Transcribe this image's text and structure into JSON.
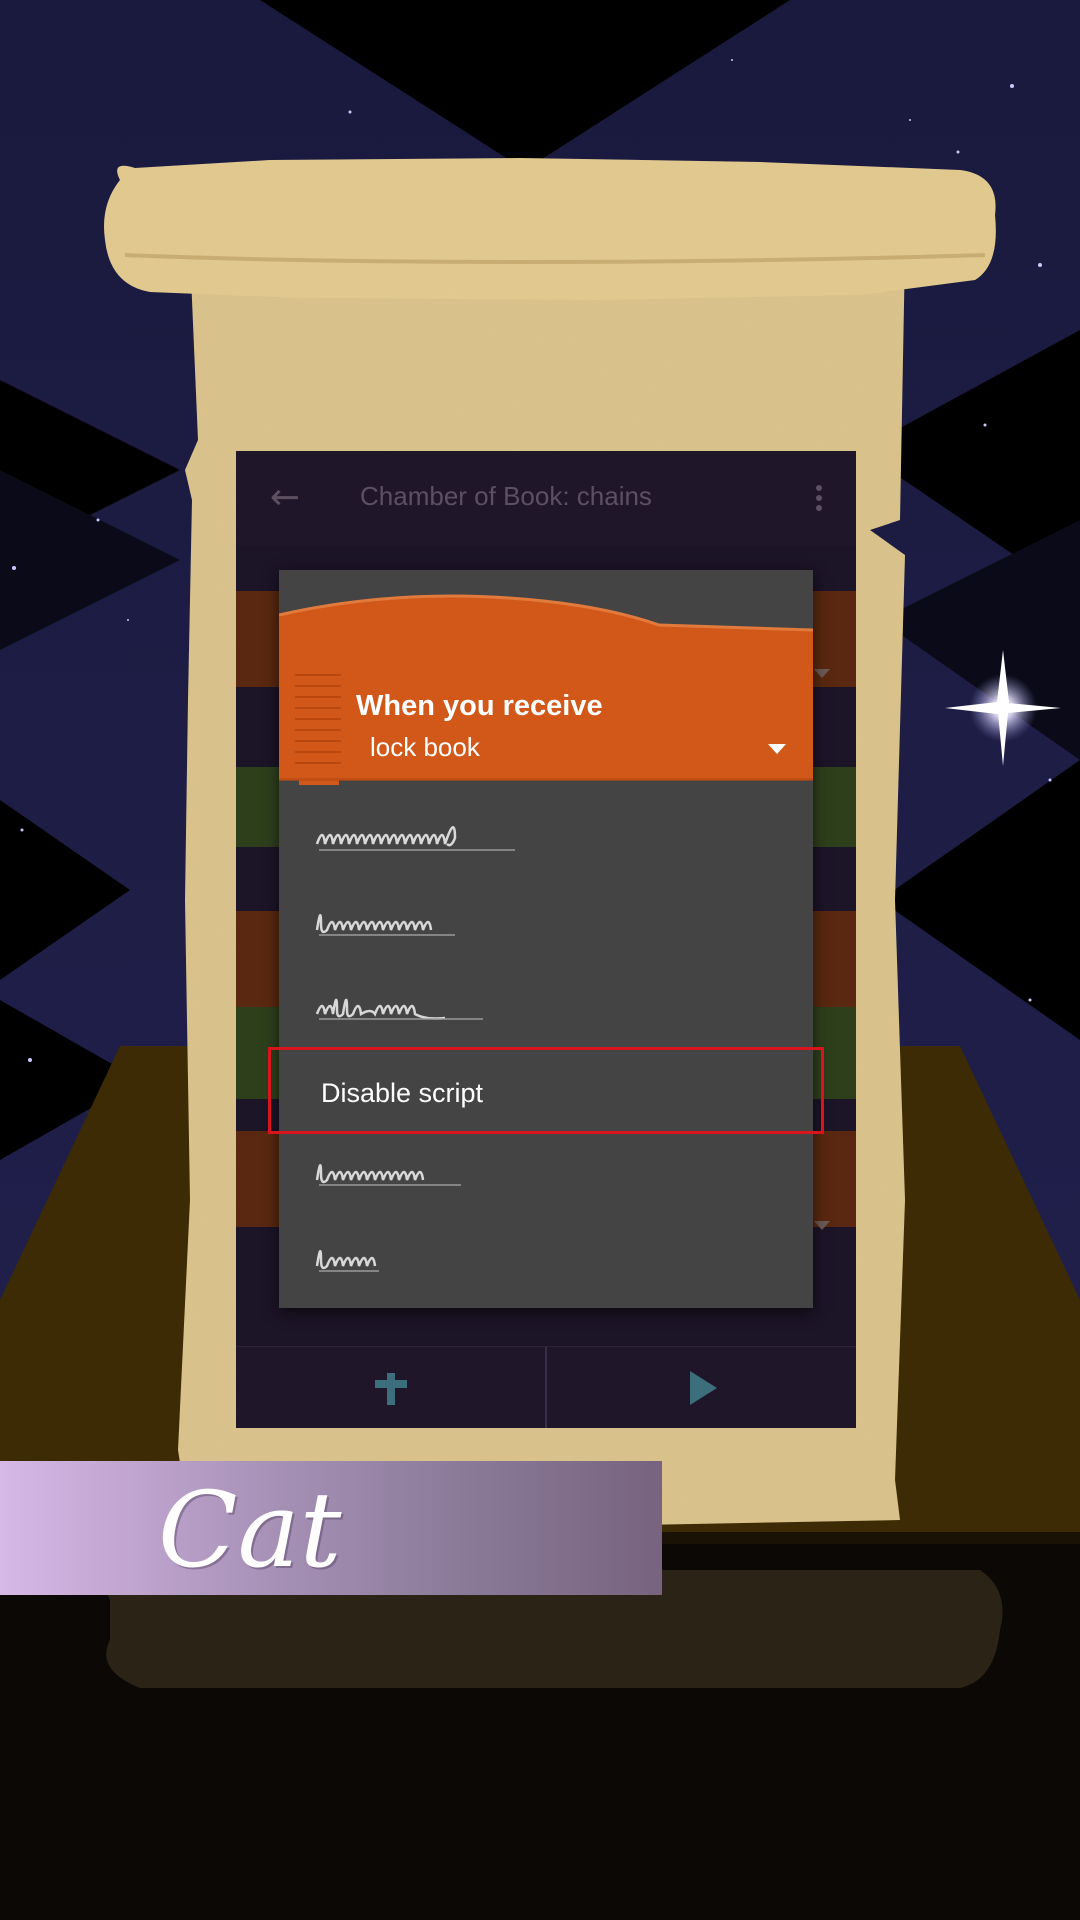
{
  "app": {
    "title": "Chamber of Book: chains"
  },
  "dialog": {
    "block_title": "When you receive",
    "selected_value": "lock book",
    "options": [
      {
        "kind": "scribble"
      },
      {
        "kind": "scribble"
      },
      {
        "kind": "scribble"
      },
      {
        "kind": "text",
        "label": "Disable script",
        "highlighted": true
      },
      {
        "kind": "scribble"
      },
      {
        "kind": "scribble"
      }
    ]
  },
  "character": {
    "name": "Cat"
  },
  "icons": {
    "back": "arrow-left-icon",
    "menu": "more-vert-icon",
    "add": "plus-icon",
    "play": "play-icon"
  },
  "colors": {
    "block_orange": "#d2581a",
    "dialog_bg": "#444444",
    "highlight": "#d8141c",
    "parchment": "#dcc48e",
    "night_sky": "#1c1a44"
  }
}
